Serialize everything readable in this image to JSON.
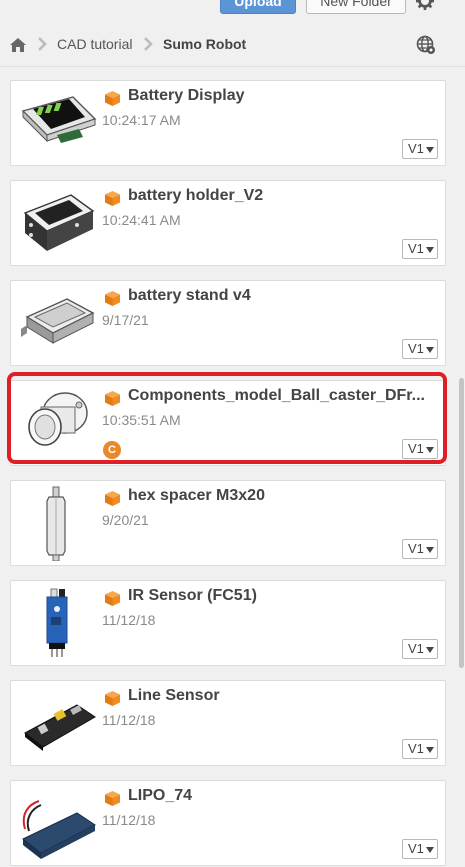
{
  "toolbar": {
    "upload_label": "Upload",
    "new_folder_label": "New Folder"
  },
  "breadcrumb": {
    "items": [
      "CAD tutorial",
      "Sumo Robot"
    ]
  },
  "files": [
    {
      "name": "Battery Display",
      "date": "10:24:17 AM",
      "version": "V1"
    },
    {
      "name": "battery holder_V2",
      "date": "10:24:41 AM",
      "version": "V1"
    },
    {
      "name": "battery stand v4",
      "date": "9/17/21",
      "version": "V1"
    },
    {
      "name": "Components_model_Ball_caster_DFr...",
      "date": "10:35:51 AM",
      "version": "V1",
      "badge": "C"
    },
    {
      "name": "hex spacer M3x20",
      "date": "9/20/21",
      "version": "V1"
    },
    {
      "name": "IR Sensor (FC51)",
      "date": "11/12/18",
      "version": "V1"
    },
    {
      "name": "Line Sensor",
      "date": "11/12/18",
      "version": "V1"
    },
    {
      "name": "LIPO_74",
      "date": "11/12/18",
      "version": "V1"
    }
  ],
  "colors": {
    "accent": "#5b95d6",
    "design_icon": "#f08a24",
    "highlight": "#e01e26",
    "badge": "#e8892b"
  },
  "icons": {
    "home": "home-icon",
    "chevron": "chevron-right-icon",
    "settings": "gear-icon",
    "globe": "globe-icon",
    "design": "design-cube-icon"
  }
}
